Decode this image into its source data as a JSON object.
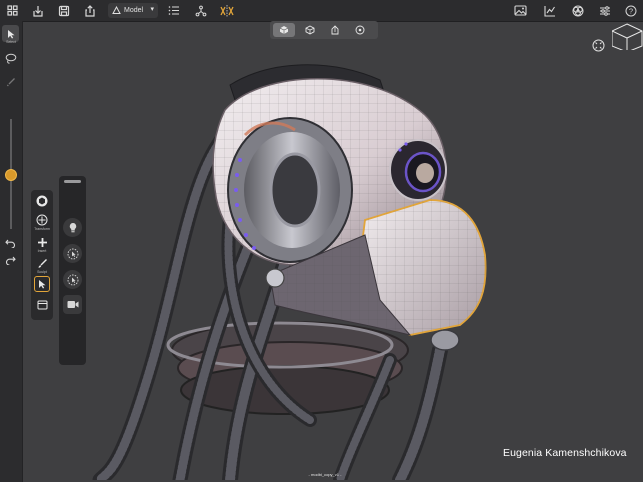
{
  "toolbar": {
    "mode_label": "Model",
    "icons": [
      "grid-icon",
      "import-icon",
      "save-icon",
      "share-icon",
      "model-mode-icon",
      "list-icon",
      "nodes-icon",
      "symmetry-icon",
      "image-icon",
      "chart-icon",
      "shader-icon",
      "settings-sliders-icon",
      "help-icon"
    ]
  },
  "view_modes": {
    "active": 0,
    "items": [
      "shaded-view-icon",
      "cube-view-icon",
      "pen-view-icon",
      "point-view-icon"
    ]
  },
  "left_rail": {
    "select_label": "Select",
    "slider_value": 0.5
  },
  "tool_strip": {
    "transform_label": "Transform",
    "insert_label": "Insert",
    "sculpt_label": "Sculpt",
    "active_index": 4
  },
  "canvas": {
    "artist_credit": "Eugenia Kamenshchikova",
    "file_name": "- modbi_copy_v1 -"
  },
  "colors": {
    "accent": "#e2a53a",
    "topbar": "#2c2c2e",
    "viewport": "#3f3f41"
  }
}
